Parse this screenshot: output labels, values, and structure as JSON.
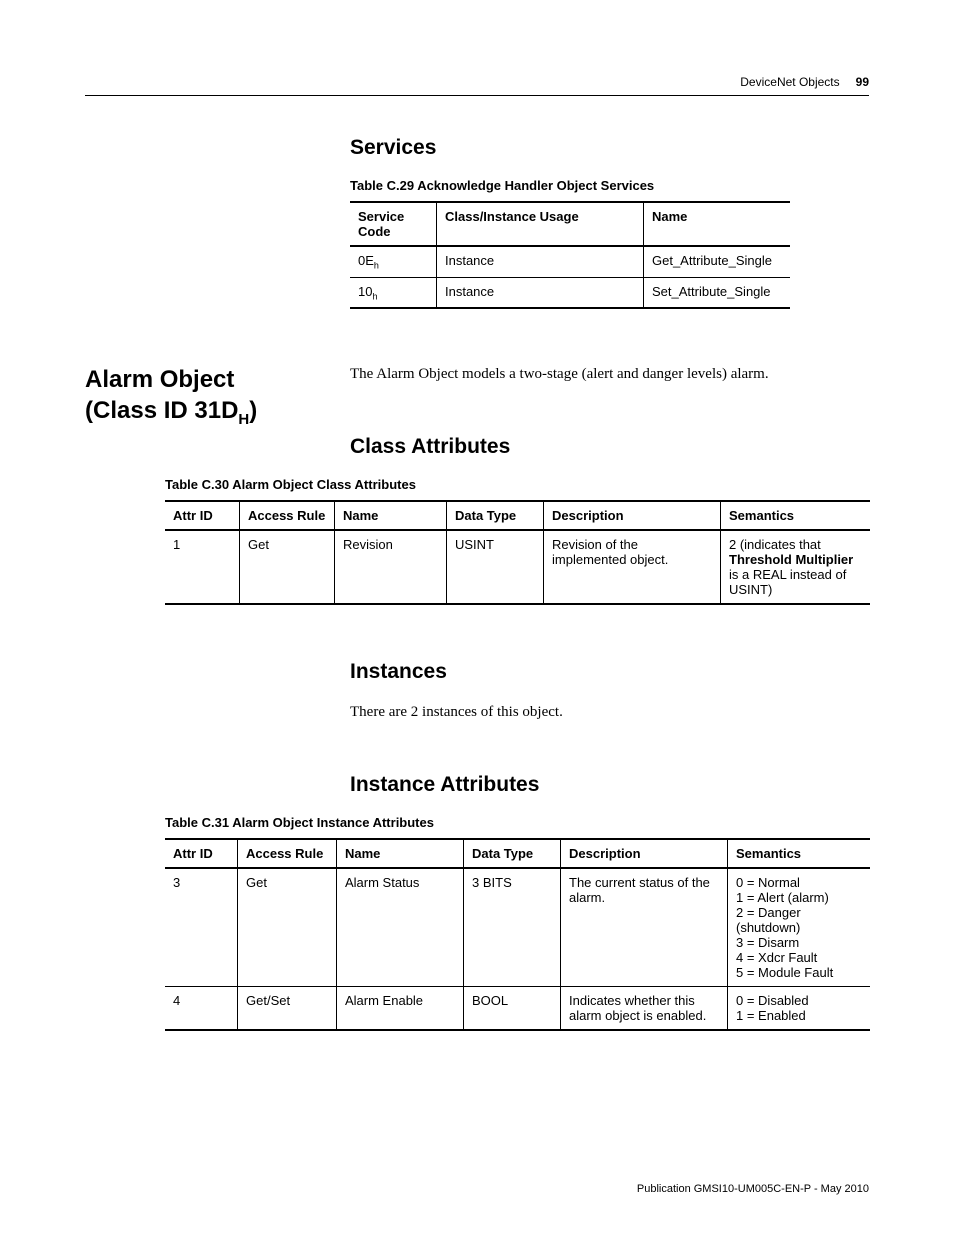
{
  "header": {
    "chapter": "DeviceNet Objects",
    "page": "99"
  },
  "services": {
    "heading": "Services",
    "caption": "Table C.29 Acknowledge Handler Object Services",
    "columns": [
      "Service Code",
      "Class/Instance Usage",
      "Name"
    ],
    "rows": [
      {
        "code": "0E",
        "sub": "h",
        "usage": "Instance",
        "name": "Get_Attribute_Single"
      },
      {
        "code": "10",
        "sub": "h",
        "usage": "Instance",
        "name": "Set_Attribute_Single"
      }
    ]
  },
  "alarm": {
    "title_line1": "Alarm Object",
    "title_line2_pre": "(Class ID 31D",
    "title_line2_sub": "H",
    "title_line2_post": ")",
    "intro": "The Alarm Object models a two-stage (alert and danger levels) alarm."
  },
  "class_attrs": {
    "heading": "Class Attributes",
    "caption": "Table C.30 Alarm Object Class Attributes",
    "columns": [
      "Attr ID",
      "Access Rule",
      "Name",
      "Data Type",
      "Description",
      "Semantics"
    ],
    "row": {
      "attr_id": "1",
      "access": "Get",
      "name": "Revision",
      "dtype": "USINT",
      "desc": "Revision of the implemented object.",
      "sem_pre": "2 (indicates that ",
      "sem_bold": "Threshold Multiplier",
      "sem_post": " is a REAL instead of USINT)"
    }
  },
  "instances": {
    "heading": "Instances",
    "text": "There are 2 instances of this object."
  },
  "inst_attrs": {
    "heading": "Instance Attributes",
    "caption": "Table C.31 Alarm Object Instance Attributes",
    "columns": [
      "Attr ID",
      "Access Rule",
      "Name",
      "Data Type",
      "Description",
      "Semantics"
    ],
    "rows": [
      {
        "attr_id": "3",
        "access": "Get",
        "name": "Alarm Status",
        "dtype": "3 BITS",
        "desc": "The current status of the alarm.",
        "sem": "0 = Normal\n1 = Alert (alarm)\n2 = Danger (shutdown)\n3 = Disarm\n4 = Xdcr Fault\n5 = Module Fault"
      },
      {
        "attr_id": "4",
        "access": "Get/Set",
        "name": "Alarm Enable",
        "dtype": "BOOL",
        "desc": "Indicates whether this alarm object is enabled.",
        "sem": "0 = Disabled\n1 = Enabled"
      }
    ]
  },
  "footer": "Publication GMSI10-UM005C-EN-P - May 2010"
}
